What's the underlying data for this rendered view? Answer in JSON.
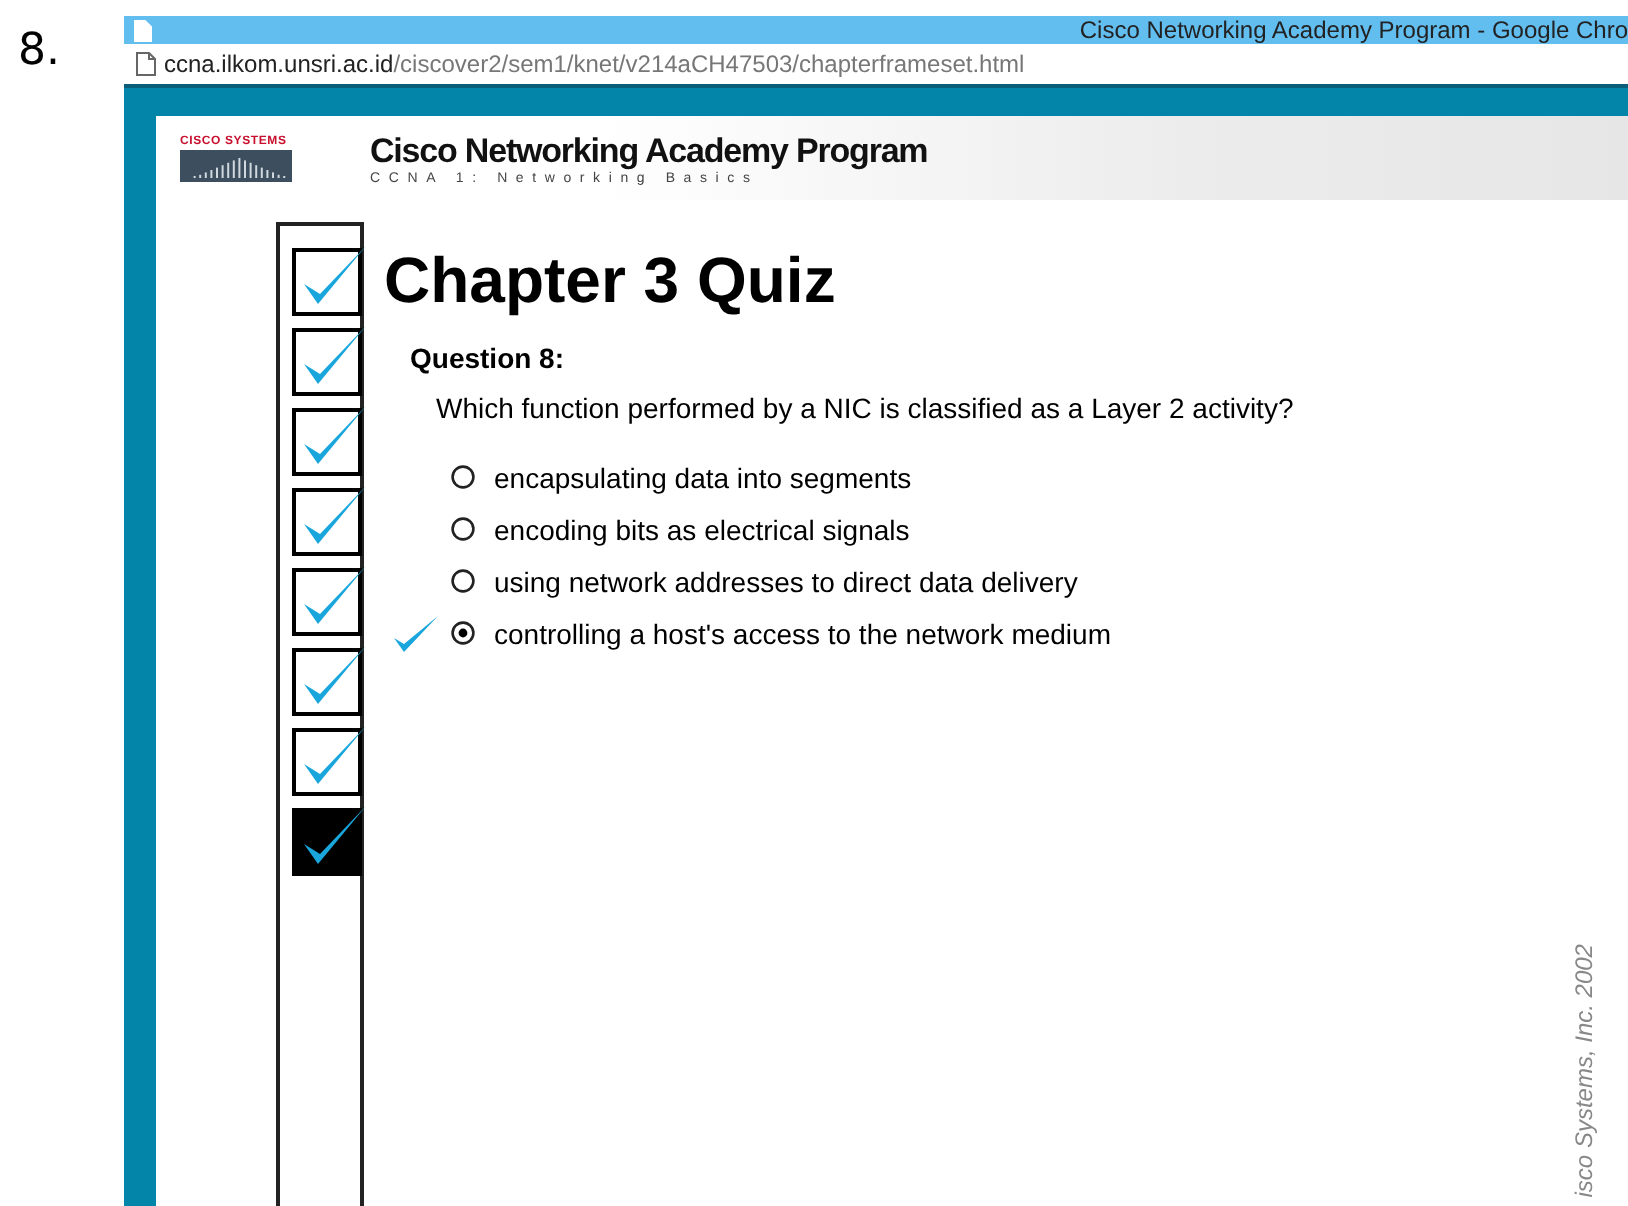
{
  "item_number": "8.",
  "browser": {
    "title": "Cisco Networking Academy Program - Google Chro",
    "url_domain": "ccna.ilkom.unsri.ac.id",
    "url_path": "/ciscover2/sem1/knet/v214aCH47503/chapterframeset.html"
  },
  "header": {
    "logo_text": "CISCO SYSTEMS",
    "title": "Cisco Networking Academy Program",
    "subtitle": "CCNA 1: Networking Basics"
  },
  "progress": [
    {
      "current": false
    },
    {
      "current": false
    },
    {
      "current": false
    },
    {
      "current": false
    },
    {
      "current": false
    },
    {
      "current": false
    },
    {
      "current": false
    },
    {
      "current": true
    }
  ],
  "quiz": {
    "title": "Chapter 3 Quiz",
    "question_label": "Question 8:",
    "question": "Which function performed by a NIC is classified as a Layer 2 activity?",
    "options": [
      {
        "text": "encapsulating data into segments",
        "selected": false,
        "correct": false
      },
      {
        "text": "encoding bits as electrical signals",
        "selected": false,
        "correct": false
      },
      {
        "text": "using network addresses to direct data delivery",
        "selected": false,
        "correct": false
      },
      {
        "text": "controlling a host's access to the network medium",
        "selected": true,
        "correct": true
      }
    ]
  },
  "copyright": "isco Systems, Inc. 2002"
}
